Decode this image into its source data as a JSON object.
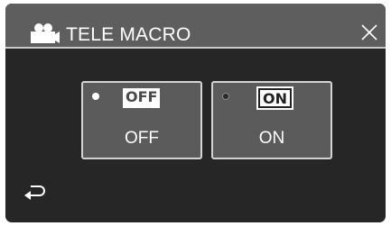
{
  "header": {
    "icon": "video-camera-icon",
    "title": "TELE MACRO",
    "close_icon": "close-icon"
  },
  "options": [
    {
      "badge": "OFF",
      "label": "OFF",
      "selected": false,
      "indicator": "radio-empty"
    },
    {
      "badge": "ON",
      "label": "ON",
      "selected": true,
      "indicator": "radio-filled"
    }
  ],
  "footer": {
    "back_icon": "return-arrow-icon"
  },
  "colors": {
    "screen_bg": "#262626",
    "header_bg": "#5e5e5e",
    "option_bg": "#5b5b5b",
    "option_border": "#d4d4d4",
    "text": "#ffffff"
  }
}
